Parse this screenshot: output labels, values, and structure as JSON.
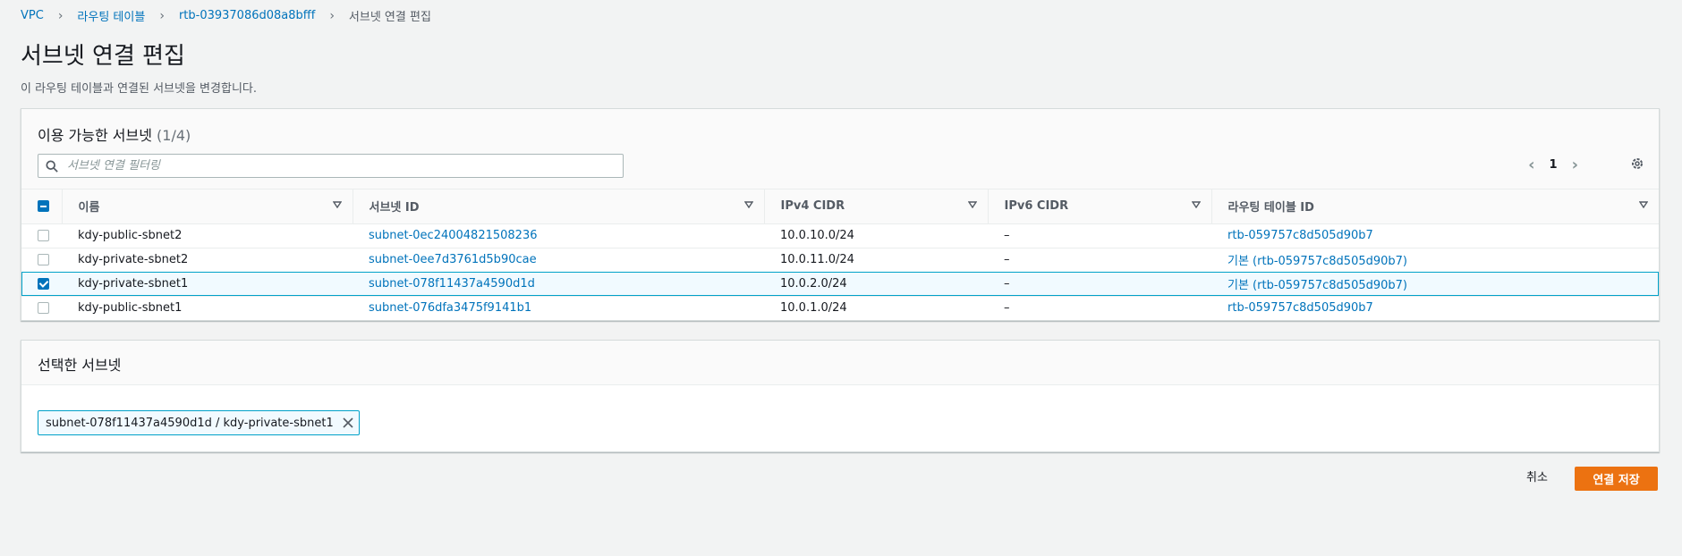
{
  "breadcrumb": {
    "items": [
      "VPC",
      "라우팅 테이블",
      "rtb-03937086d08a8bfff"
    ],
    "current": "서브넷 연결 편집"
  },
  "page": {
    "title": "서브넷 연결 편집",
    "description": "이 라우팅 테이블과 연결된 서브넷을 변경합니다."
  },
  "available": {
    "title": "이용 가능한 서브넷",
    "count": "(1/4)",
    "search_placeholder": "서브넷 연결 필터링",
    "page_number": "1",
    "columns": [
      "이름",
      "서브넷 ID",
      "IPv4 CIDR",
      "IPv6 CIDR",
      "라우팅 테이블 ID"
    ],
    "rows": [
      {
        "name": "kdy-public-sbnet2",
        "subnet_id": "subnet-0ec24004821508236",
        "ipv4": "10.0.10.0/24",
        "ipv6": "–",
        "rtb": "rtb-059757c8d505d90b7",
        "checked": false
      },
      {
        "name": "kdy-private-sbnet2",
        "subnet_id": "subnet-0ee7d3761d5b90cae",
        "ipv4": "10.0.11.0/24",
        "ipv6": "–",
        "rtb": "기본 (rtb-059757c8d505d90b7)",
        "checked": false
      },
      {
        "name": "kdy-private-sbnet1",
        "subnet_id": "subnet-078f11437a4590d1d",
        "ipv4": "10.0.2.0/24",
        "ipv6": "–",
        "rtb": "기본 (rtb-059757c8d505d90b7)",
        "checked": true
      },
      {
        "name": "kdy-public-sbnet1",
        "subnet_id": "subnet-076dfa3475f9141b1",
        "ipv4": "10.0.1.0/24",
        "ipv6": "–",
        "rtb": "rtb-059757c8d505d90b7",
        "checked": false
      }
    ]
  },
  "selected": {
    "title": "선택한 서브넷",
    "token": "subnet-078f11437a4590d1d / kdy-private-sbnet1"
  },
  "actions": {
    "cancel": "취소",
    "save": "연결 저장"
  },
  "colors": {
    "link": "#0073bb",
    "primary_button": "#ec7211",
    "selection": "#00a1c9"
  }
}
